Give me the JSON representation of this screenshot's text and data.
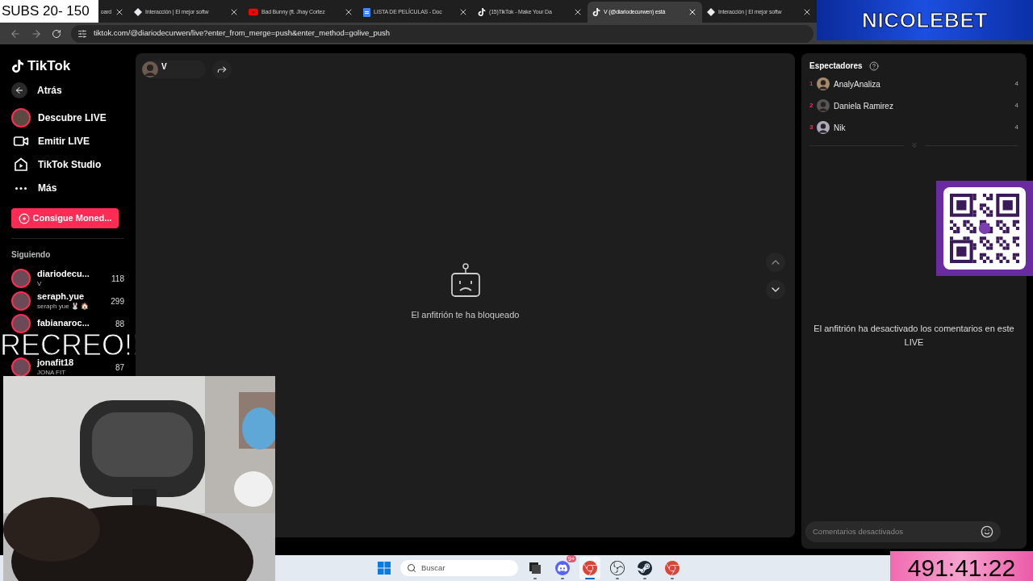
{
  "overlays": {
    "subs_counter": "SUBS 20- 150",
    "banner": "NICOLEBET",
    "caption": "RECREO!!",
    "timer": "491:41:22"
  },
  "browser": {
    "tabs": [
      {
        "title": "oard",
        "kind": "none",
        "selected": false
      },
      {
        "title": "Interacción | El mejor softw",
        "kind": "diamond",
        "selected": false
      },
      {
        "title": "Bad Bunny (ft. Jhay Cortez",
        "kind": "youtube",
        "selected": false
      },
      {
        "title": "LISTA DE PELÍCULAS - Doc",
        "kind": "docs",
        "selected": false
      },
      {
        "title": "(15)TikTok - Make Your Da",
        "kind": "tiktok",
        "selected": false
      },
      {
        "title": "V (@diariodecurwen) está",
        "kind": "tiktok",
        "selected": true
      },
      {
        "title": "Interacción | El mejor softw",
        "kind": "diamond",
        "selected": false
      }
    ],
    "url": "tiktok.com/@diariodecurwen/live?enter_from_merge=push&enter_method=golive_push"
  },
  "sidebar": {
    "logo": "TikTok",
    "back": "Atrás",
    "nav": [
      {
        "label": "Descubre LIVE",
        "kind": "avatar"
      },
      {
        "label": "Emitir LIVE",
        "kind": "camera"
      },
      {
        "label": "TikTok Studio",
        "kind": "studio"
      },
      {
        "label": "Más",
        "kind": "more"
      }
    ],
    "coins_button": "Consigue Moned...",
    "following_title": "Siguiendo",
    "following": [
      {
        "name": "diariodecu...",
        "subtitle": "V",
        "count": "118"
      },
      {
        "name": "seraph.yue",
        "subtitle": "seraph yue 🐰 🏠",
        "count": "299"
      },
      {
        "name": "fabianaroc...",
        "count": "88"
      },
      {
        "name": "jonafit18",
        "subtitle": "JONA FIT",
        "count": "87"
      }
    ]
  },
  "stream": {
    "host": "V",
    "message": "El anfitrión te ha bloqueado"
  },
  "viewers": {
    "title": "Espectadores",
    "items": [
      {
        "rank": "1",
        "name": "AnalyAnaliza",
        "count": "4"
      },
      {
        "rank": "2",
        "name": "Daniela Ramirez",
        "count": "4"
      },
      {
        "rank": "3",
        "name": "Nik",
        "count": "4"
      }
    ]
  },
  "comments": {
    "notice": "El anfitrión ha desactivado los comentarios en este LIVE",
    "placeholder": "Comentarios desactivados"
  },
  "taskbar": {
    "search_placeholder": "Buscar",
    "apps": [
      {
        "kind": "files",
        "selected": false
      },
      {
        "kind": "discord",
        "badge": "9+",
        "selected": false
      },
      {
        "kind": "chrome",
        "selected": true
      },
      {
        "kind": "obs",
        "selected": false
      },
      {
        "kind": "steam",
        "selected": false
      },
      {
        "kind": "chrome",
        "selected": false
      }
    ]
  }
}
